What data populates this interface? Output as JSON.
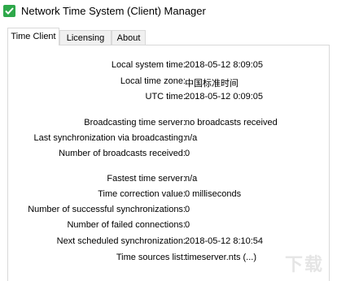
{
  "window": {
    "title": "Network Time System (Client) Manager",
    "icon": "clock-check-icon",
    "icon_color": "#2ea84a"
  },
  "tabs": [
    {
      "label": "Time Client",
      "active": true
    },
    {
      "label": "Licensing",
      "active": false
    },
    {
      "label": "About",
      "active": false
    }
  ],
  "rows": [
    {
      "label": "Local system time:",
      "value": "2018-05-12 8:09:05"
    },
    {
      "label": "Local time zone:",
      "value": "中国标准时间"
    },
    {
      "label": "UTC time:",
      "value": "2018-05-12 0:09:05"
    },
    {
      "label": "Broadcasting time server:",
      "value": "no broadcasts received"
    },
    {
      "label": "Last synchronization via broadcasting:",
      "value": "n/a"
    },
    {
      "label": "Number of broadcasts received:",
      "value": "0"
    },
    {
      "label": "Fastest time server:",
      "value": "n/a"
    },
    {
      "label": "Time correction value:",
      "value": "0 milliseconds"
    },
    {
      "label": "Number of successful synchronizations:",
      "value": "0"
    },
    {
      "label": "Number of failed connections:",
      "value": "0"
    },
    {
      "label": "Next scheduled synchronization:",
      "value": "2018-05-12 8:10:54"
    },
    {
      "label": "Time sources list:",
      "value": "timeserver.nts (...)"
    }
  ],
  "watermark": "下载"
}
